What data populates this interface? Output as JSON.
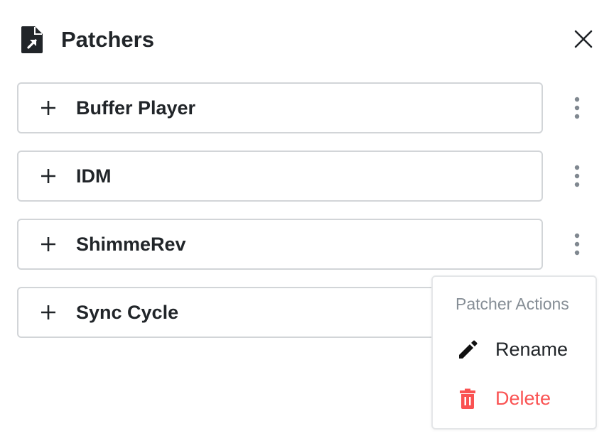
{
  "header": {
    "title": "Patchers",
    "icon": "file-export-icon",
    "close_icon": "close-icon"
  },
  "patchers": [
    {
      "label": "Buffer Player",
      "icon": "plus-icon"
    },
    {
      "label": "IDM",
      "icon": "plus-icon"
    },
    {
      "label": "ShimmeRev",
      "icon": "plus-icon"
    },
    {
      "label": "Sync Cycle",
      "icon": "plus-icon"
    }
  ],
  "menu": {
    "header": "Patcher Actions",
    "items": [
      {
        "label": "Rename",
        "icon": "pencil-icon"
      },
      {
        "label": "Delete",
        "icon": "trash-icon"
      }
    ]
  },
  "colors": {
    "text": "#212529",
    "muted": "#868e96",
    "danger": "#fa5252",
    "border": "#d2d5d8"
  }
}
